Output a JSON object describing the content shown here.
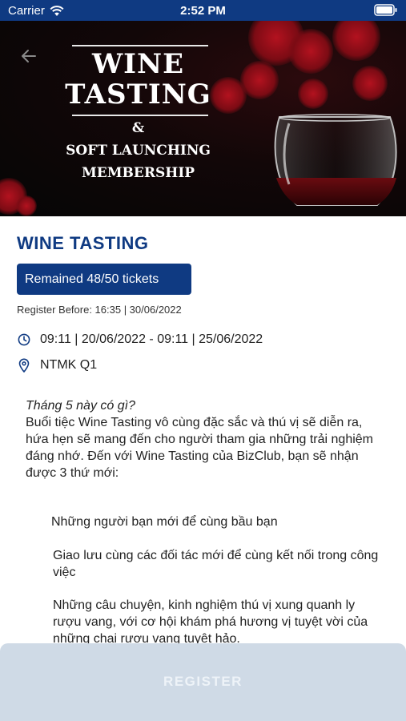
{
  "status_bar": {
    "carrier": "Carrier",
    "time": "2:52 PM",
    "icons": [
      "wifi-icon",
      "battery-icon"
    ]
  },
  "banner": {
    "back_icon": "arrow-left-icon",
    "title_line1": "WINE",
    "title_line2": "TASTING",
    "ampersand": "&",
    "subtitle_line1": "SOFT LAUNCHING",
    "subtitle_line2": "MEMBERSHIP"
  },
  "event": {
    "title": "WINE TASTING",
    "tickets": "Remained 48/50 tickets",
    "register_before": "Register Before: 16:35 | 30/06/2022",
    "time_icon": "clock-icon",
    "time_range": "09:11 | 20/06/2022 - 09:11 | 25/06/2022",
    "location_icon": "map-pin-icon",
    "location": "NTMK Q1"
  },
  "description": {
    "intro_italic": "Tháng 5 này có gì?",
    "body": "Buổi tiệc Wine Tasting vô cùng đặc sắc và thú vị sẽ diễn ra, hứa hẹn sẽ mang đến cho người tham gia những trải nghiệm đáng nhớ. Đến với Wine Tasting của BizClub, bạn sẽ nhận được 3 thứ mới:",
    "bullets": [
      "Những người bạn mới để cùng bầu bạn",
      "Giao lưu cùng các đối tác mới để cùng kết nối trong công việc",
      "Những câu chuyện, kinh nghiệm thú vị xung quanh ly rượu vang, với cơ hội khám phá hương vị tuyệt vời của những chai rượu vang tuyệt hảo."
    ]
  },
  "footer": {
    "register_label": "REGISTER"
  },
  "colors": {
    "primary": "#0f3a82",
    "footer_bg": "#cfdae6",
    "wine_red": "#b3121f"
  }
}
